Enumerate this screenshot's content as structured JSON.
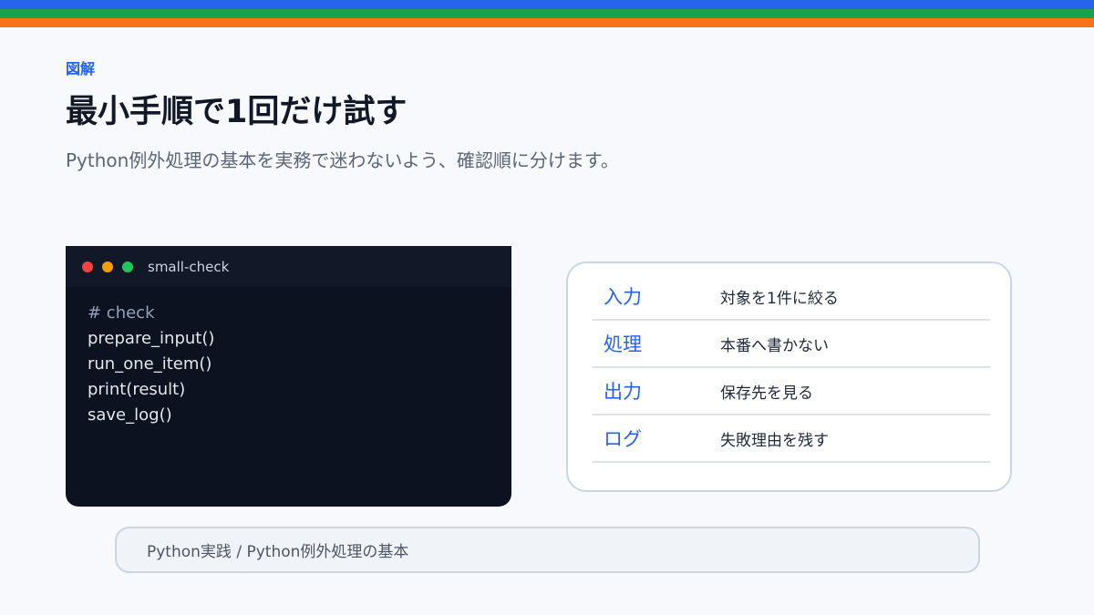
{
  "colors": {
    "stripe_top": "#2563eb",
    "stripe_middle": "#16a34a",
    "stripe_bottom": "#f97316",
    "accent": "#2563eb"
  },
  "header": {
    "eyebrow": "図解",
    "title": "最小手順で1回だけ試す",
    "subtitle": "Python例外処理の基本を実務で迷わないよう、確認順に分けます。"
  },
  "terminal": {
    "title": "small-check",
    "lines": [
      "# check",
      "prepare_input()",
      "run_one_item()",
      "print(result)",
      "save_log()"
    ]
  },
  "table": {
    "rows": [
      {
        "key": "入力",
        "value": "対象を1件に絞る"
      },
      {
        "key": "処理",
        "value": "本番へ書かない"
      },
      {
        "key": "出力",
        "value": "保存先を見る"
      },
      {
        "key": "ログ",
        "value": "失敗理由を残す"
      }
    ]
  },
  "footer": {
    "breadcrumb": "Python実践 / Python例外処理の基本"
  }
}
